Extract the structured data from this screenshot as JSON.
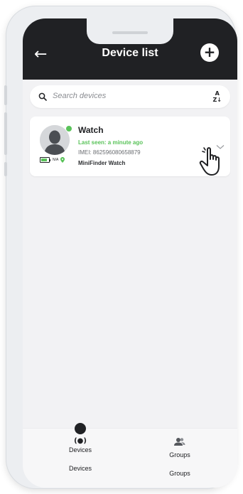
{
  "header": {
    "title": "Device list",
    "back_icon": "arrow-left-icon",
    "add_icon": "plus-icon",
    "back_glyph": "←",
    "add_glyph": "+"
  },
  "search": {
    "placeholder": "Search devices",
    "search_icon": "search-icon",
    "sort_icon": "sort-az-icon",
    "sort_top": "A",
    "sort_bottom": "Z↓"
  },
  "devices": [
    {
      "name": "Watch",
      "last_seen": "Last seen: a minute ago",
      "imei": "IMEI: 862596080658879",
      "model": "MiniFinder Watch",
      "status": "N/A",
      "online": true,
      "battery_level": 0.8
    }
  ],
  "bottom_nav": {
    "items": [
      {
        "label": "Devices",
        "icon": "broadcast-icon",
        "glyph": "(●)",
        "sub_label": "Devices"
      },
      {
        "label": "Groups",
        "icon": "people-icon",
        "sub_label": "Groups"
      }
    ]
  },
  "colors": {
    "header_bg": "#202124",
    "accent_green": "#5ac35a",
    "screen_bg": "#f2f2f4"
  }
}
